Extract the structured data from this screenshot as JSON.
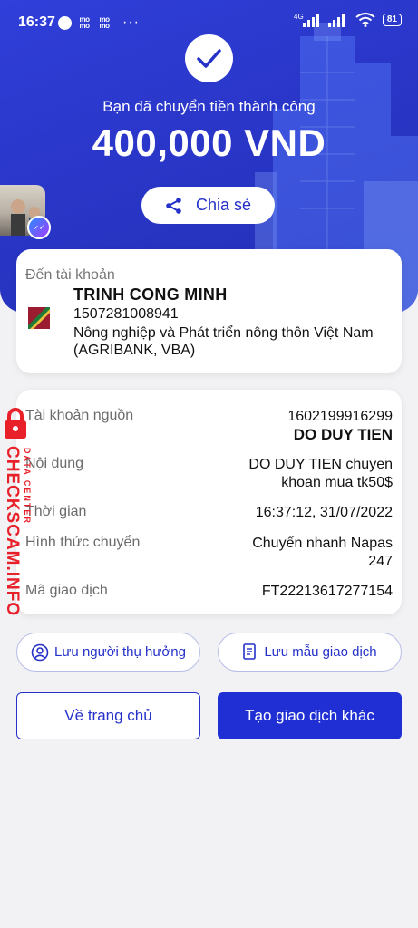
{
  "status_bar": {
    "time": "16:37",
    "app_icons": [
      "messenger-icon",
      "momo-icon",
      "momo-icon"
    ],
    "overflow": "···",
    "network": "4G",
    "battery": "81"
  },
  "hero": {
    "success_message": "Bạn đã chuyển tiền thành công",
    "amount": "400,000 VND",
    "share_label": "Chia sẻ",
    "background_color": "#2a36c8"
  },
  "destination": {
    "label": "Đến tài khoản",
    "name": "TRINH CONG MINH",
    "account_number": "1507281008941",
    "bank": "Nông nghiệp và Phát triển nông thôn Việt Nam (AGRIBANK, VBA)"
  },
  "details": {
    "source_label": "Tài khoản nguồn",
    "source_account": "1602199916299",
    "source_name": "DO DUY TIEN",
    "content_label": "Nội dung",
    "content_line1": "DO DUY TIEN chuyen",
    "content_line2": "khoan mua tk50$",
    "time_label": "Thời gian",
    "time_value": "16:37:12, 31/07/2022",
    "method_label": "Hình thức chuyển",
    "method_line1": "Chuyển nhanh Napas",
    "method_line2": "247",
    "txn_label": "Mã giao dịch",
    "txn_value": "FT22213617277154"
  },
  "actions": {
    "save_payee": "Lưu người thụ hưởng",
    "save_template": "Lưu mẫu giao dịch",
    "home": "Về trang chủ",
    "new_transaction": "Tạo giao dịch khác"
  },
  "watermark": {
    "text": "CHECKSCAM.INFO",
    "sub": "DATA CENTER"
  },
  "colors": {
    "primary": "#1f2fd4",
    "hero": "#2a36c8",
    "watermark": "#e8202a"
  }
}
